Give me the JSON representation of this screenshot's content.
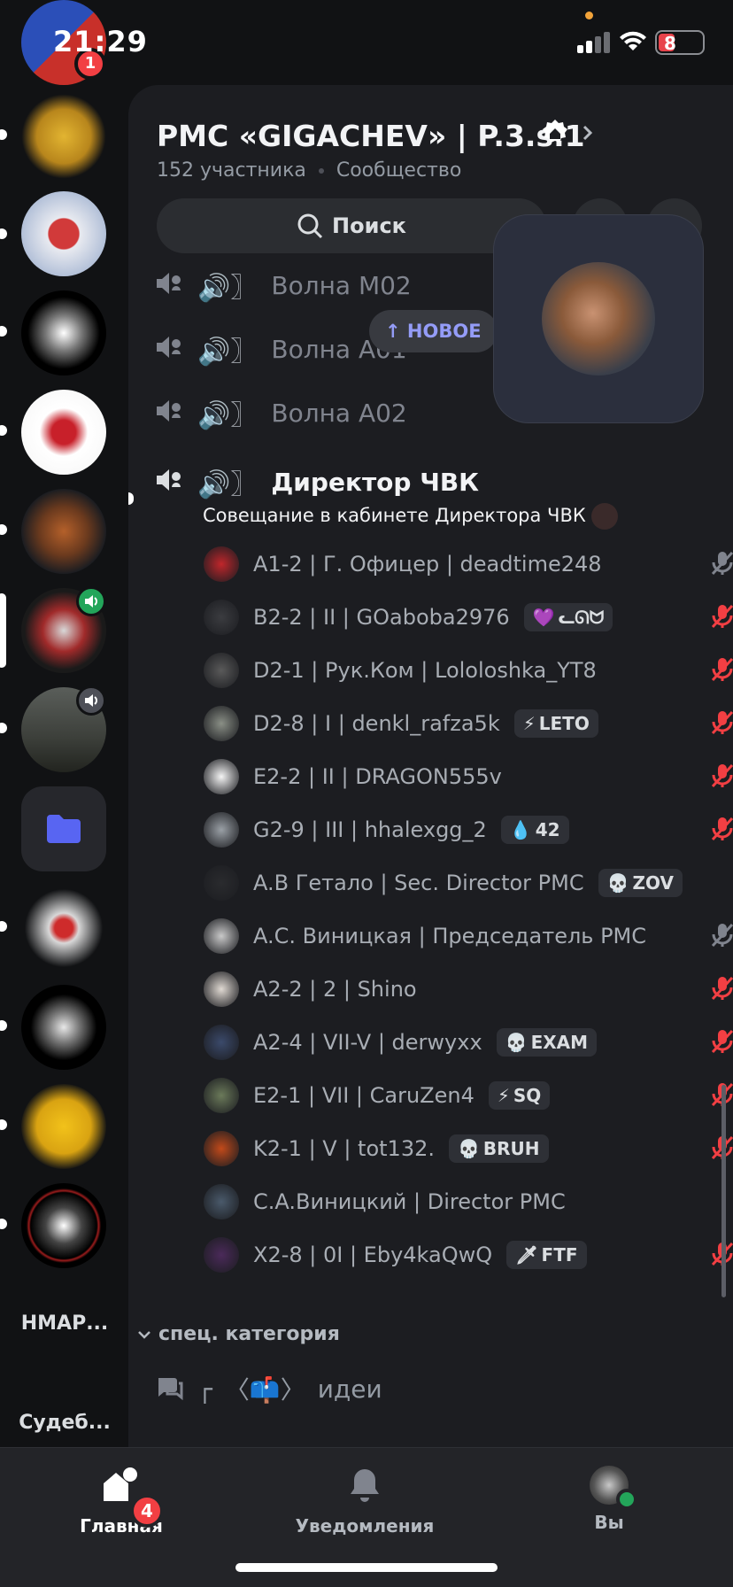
{
  "status_bar": {
    "time": "21:29",
    "battery": "8"
  },
  "rail": {
    "first_badge": "1",
    "folder_label": "НМАР...",
    "last_label": "Судеб..."
  },
  "server": {
    "name": "PMC «GIGACHEV» | P.3.s.1",
    "members": "152 участника",
    "type": "Сообщество",
    "search_label": "Поиск"
  },
  "channels": [
    {
      "name": "Волна М02"
    },
    {
      "name": "Волна А01"
    },
    {
      "name": "Волна А02"
    }
  ],
  "new_pill": "↑ НОВОЕ",
  "active_channel": {
    "name": "Директор ЧВК",
    "status": "Совещание в кабинете Директора ЧВК"
  },
  "members": [
    {
      "name": "A1-2 | Г. Офицер | deadtime248",
      "tag": "",
      "tag_icon": "",
      "mic": "muted-grey",
      "avatar": "#c0262b"
    },
    {
      "name": "B2-2 | II | GOaboba2976",
      "tag": "ᓚᘏᗢ",
      "tag_icon": "💜",
      "mic": "muted-red",
      "avatar": "#3b3c40"
    },
    {
      "name": "D2-1 | Рук.Ком | Lololoshka_YT8",
      "tag": "",
      "tag_icon": "",
      "mic": "muted-red",
      "avatar": "#5a5a5a"
    },
    {
      "name": "D2-8 | I | denkl_rafza5k",
      "tag": "LETO",
      "tag_icon": "⚡",
      "mic": "muted-red",
      "avatar": "#8a8f86"
    },
    {
      "name": "E2-2 | II | DRAGON555v",
      "tag": "",
      "tag_icon": "",
      "mic": "muted-red",
      "avatar": "#f5f5f5"
    },
    {
      "name": "G2-9 | III | hhalexgg_2",
      "tag": "42",
      "tag_icon": "💧",
      "mic": "muted-red",
      "avatar": "#9aa0a6"
    },
    {
      "name": "A.B Гетало | Sec. Director PMC",
      "tag": "ZOV",
      "tag_icon": "💀",
      "mic": "",
      "avatar": "#2a2b2e"
    },
    {
      "name": "A.C. Виницкая | Председатель PMC",
      "tag": "",
      "tag_icon": "",
      "mic": "muted-grey",
      "avatar": "#c9c9c9"
    },
    {
      "name": "A2-2 | 2 | Shino",
      "tag": "",
      "tag_icon": "",
      "mic": "muted-red",
      "avatar": "#e0d9d2"
    },
    {
      "name": "A2-4 | VII-V | derwyxx",
      "tag": "EXAM",
      "tag_icon": "💀",
      "mic": "muted-red",
      "avatar": "#3b4a6b"
    },
    {
      "name": "E2-1 | VII | CaruZen4",
      "tag": "SQ",
      "tag_icon": "⚡",
      "mic": "muted-red",
      "avatar": "#6b7a5a"
    },
    {
      "name": "K2-1 | V | tot132.",
      "tag": "BRUH",
      "tag_icon": "💀",
      "mic": "muted-red",
      "avatar": "#c24a1a"
    },
    {
      "name": "C.A.Виницкий | Director PMC",
      "tag": "",
      "tag_icon": "",
      "mic": "",
      "avatar": "#4a5a6b"
    },
    {
      "name": "X2-8 | 0I | Eby4kaQwQ",
      "tag": "FTF",
      "tag_icon": "🗡",
      "mic": "muted-red",
      "avatar": "#4b2a5a"
    }
  ],
  "category": {
    "name": "спец. категория"
  },
  "text_channel": {
    "prefix": "┌",
    "emoji": "〈📫〉",
    "name": "идеи"
  },
  "nav": {
    "home": "Главная",
    "home_badge": "4",
    "notifications": "Уведомления",
    "you": "Вы"
  }
}
